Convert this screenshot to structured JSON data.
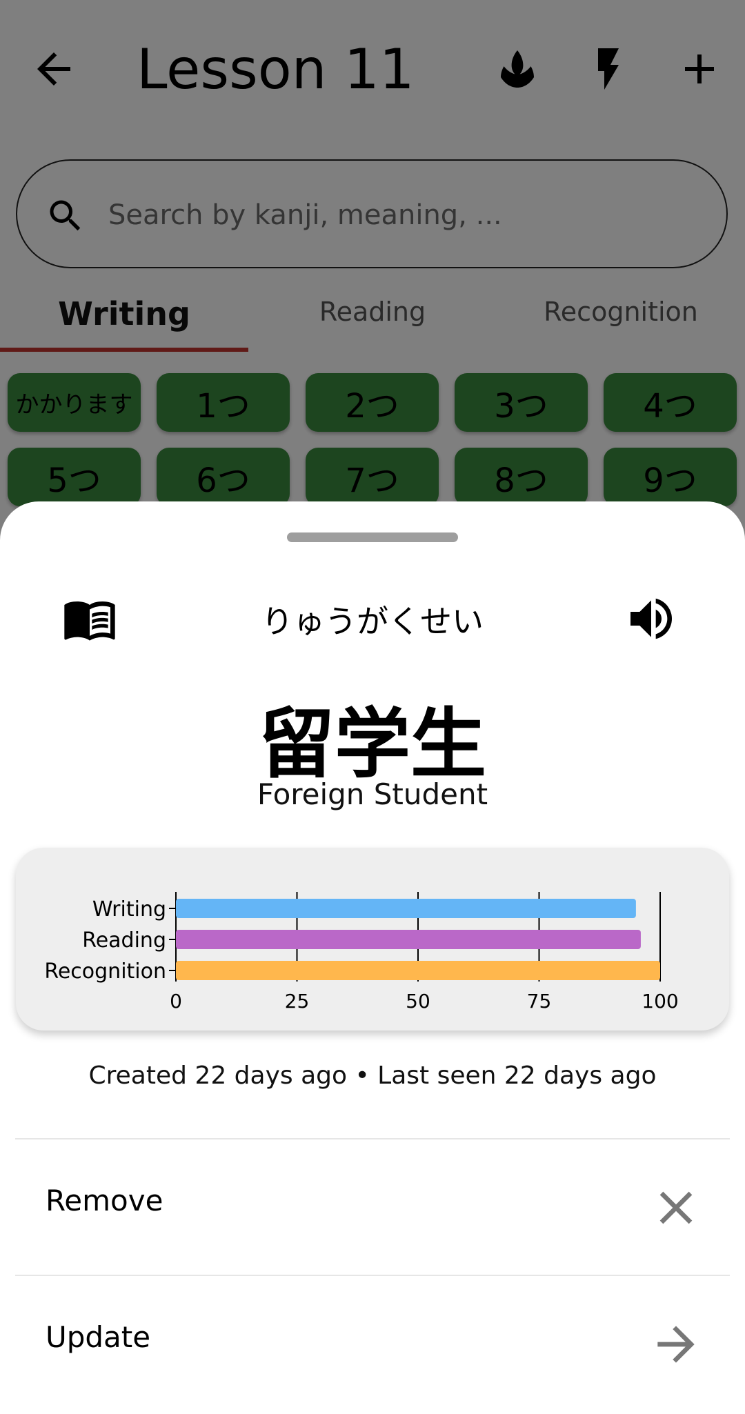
{
  "appbar": {
    "title": "Lesson 11",
    "icons": [
      "back-arrow-icon",
      "lotus-icon",
      "lightning-icon",
      "plus-icon"
    ]
  },
  "search": {
    "placeholder": "Search by kanji, meaning, ..."
  },
  "tabs": [
    {
      "label": "Writing",
      "active": true
    },
    {
      "label": "Reading",
      "active": false
    },
    {
      "label": "Recognition",
      "active": false
    }
  ],
  "chips": [
    "かかります",
    "1つ",
    "2つ",
    "3つ",
    "4つ",
    "5つ",
    "6つ",
    "7つ",
    "8つ",
    "9つ"
  ],
  "sheet": {
    "reading": "りゅうがくせい",
    "kanji": "留学生",
    "meaning": "Foreign Student",
    "meta": "Created 22 days ago • Last seen 22 days ago",
    "actions": [
      {
        "label": "Remove",
        "icon": "close-icon"
      },
      {
        "label": "Update",
        "icon": "arrow-right-icon"
      }
    ]
  },
  "colors": {
    "chip_green": "#3a8a3f",
    "tab_indicator": "#c0352e",
    "writing_bar": "#64b5f6",
    "reading_bar": "#ba68c8",
    "recognition_bar": "#ffb74d"
  },
  "chart_data": {
    "type": "bar",
    "orientation": "horizontal",
    "categories": [
      "Writing",
      "Reading",
      "Recognition"
    ],
    "values": [
      95,
      96,
      100
    ],
    "xlim": [
      0,
      100
    ],
    "xticks": [
      0,
      25,
      50,
      75,
      100
    ],
    "grid": true,
    "colors": [
      "#64b5f6",
      "#ba68c8",
      "#ffb74d"
    ]
  }
}
